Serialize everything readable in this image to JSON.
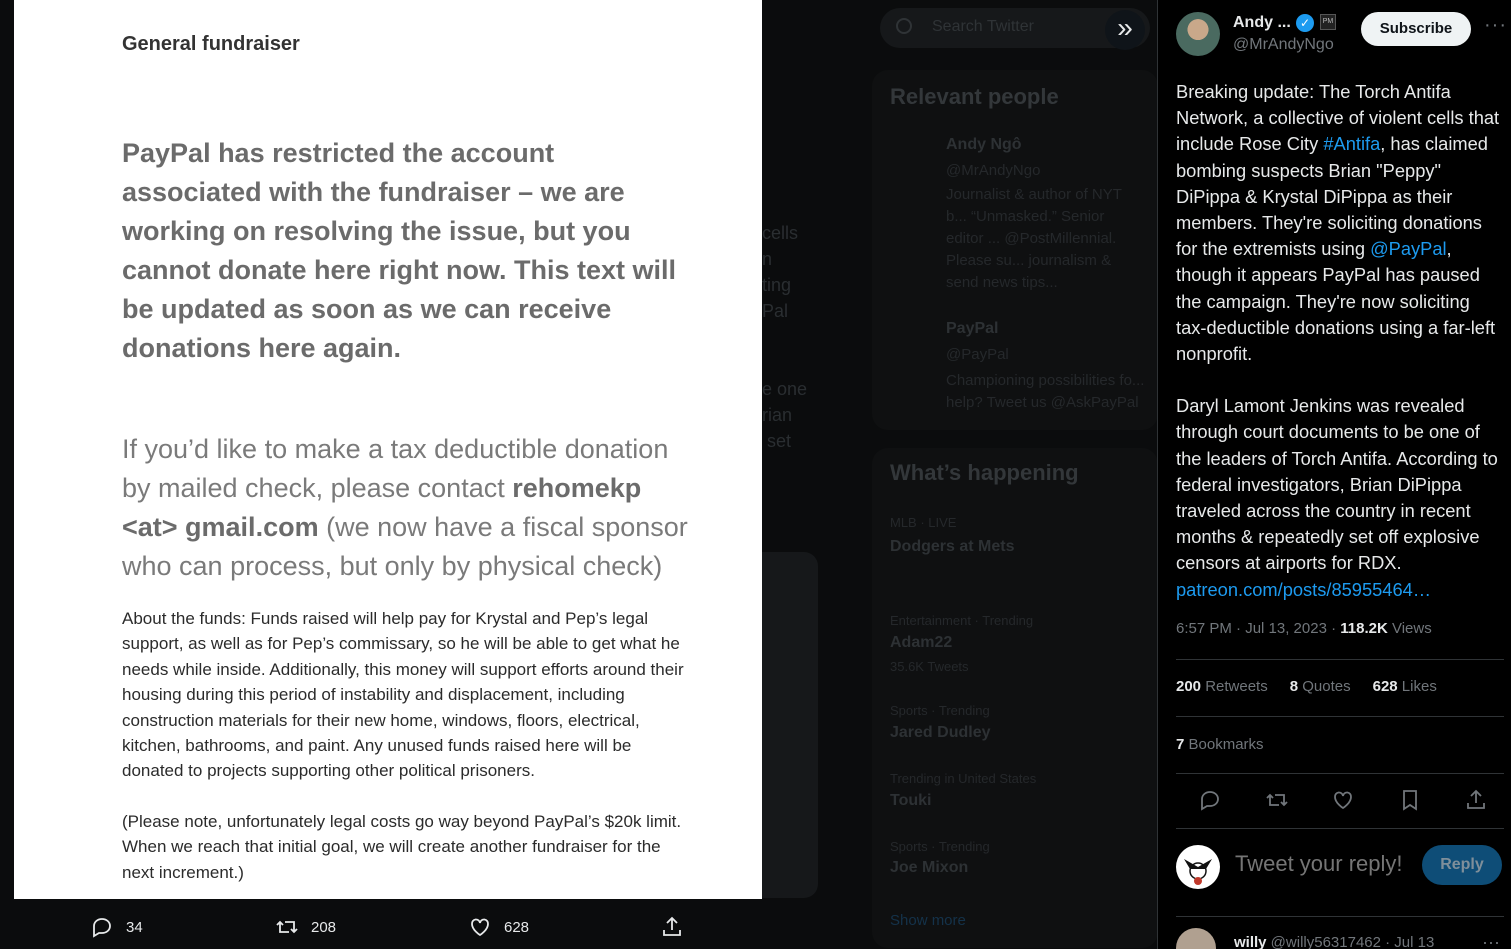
{
  "background": {
    "search_placeholder": "Search Twitter",
    "relevant_people_heading": "Relevant people",
    "rp1_name": "Andy Ngô",
    "rp1_handle": "@MrAndyNgo",
    "rp1_bio": "Journalist & author of NYT b... “Unmasked.” Senior editor ... @PostMillennial. Please su... journalism & send news tips... linktr.ee/andyngo",
    "rp2_name": "PayPal",
    "rp2_handle": "@PayPal",
    "rp2_bio": "Championing possibilities fo... help? Tweet us @AskPayPal",
    "whats_happening_heading": "What’s happening",
    "trend1_meta": "MLB · LIVE",
    "trend1_title": "Dodgers at Mets",
    "trend2_meta": "Entertainment · Trending",
    "trend2_title": "Adam22",
    "trend2_count": "35.6K Tweets",
    "trend3_meta": "Sports · Trending",
    "trend3_title": "Jared Dudley",
    "trend4_meta": "Trending in United States",
    "trend4_title": "Touki",
    "trend5_meta": "Sports · Trending",
    "trend5_title": "Joe Mixon",
    "show_more": "Show more",
    "mid_text": "cells\nn\nting\nPal\n\n\ne one\nrian\n set"
  },
  "photo": {
    "title": "General fundraiser",
    "notice": "PayPal has restricted the account associated with the fundraiser – we are working on resolving the issue, but you cannot donate here right now. This text will be updated as soon as we can receive donations here again.",
    "tax_prefix": "If you’d like to make a tax deductible donation by mailed check, please contact ",
    "tax_email": "rehomekp <at> gmail.com",
    "tax_suffix": " (we now have a fiscal sponsor who can process, but only by physical check)",
    "funds": "About the funds: Funds raised will help pay for Krystal and Pep’s legal support, as well as for Pep’s commissary, so he will be able to get what he needs while inside. Additionally, this money will support efforts around their housing during this period of instability and displacement, including construction materials for their new home, windows, floors, electrical, kitchen, bathrooms, and paint. Any unused funds raised here will be donated to projects supporting other political prisoners.",
    "note": "(Please note, unfortunately legal costs go way beyond PayPal’s $20k limit. When we reach that initial goal, we will create another fundraiser for the next increment.)"
  },
  "actions": {
    "replies": "34",
    "retweets": "208",
    "likes": "628"
  },
  "tweet": {
    "author_name": "Andy ...",
    "author_handle": "@MrAndyNgo",
    "subscribe_label": "Subscribe",
    "affiliate_badge": "PM",
    "p1_a": "Breaking update: The Torch Antifa Network, a collective of violent cells that include Rose City ",
    "p1_tag": "#Antifa",
    "p1_b": ", has claimed bombing suspects Brian \"Peppy\" DiPippa & Krystal DiPippa as their members. They're soliciting donations for the extremists using ",
    "p1_mention": "@PayPal",
    "p1_c": ", though it appears PayPal has paused the campaign. They're now soliciting tax-deductible donations using a far-left nonprofit.",
    "p2": "Daryl Lamont Jenkins was revealed through court documents to be one of the leaders of Torch Antifa. According to federal investigators, Brian DiPippa traveled across the country in recent months & repeatedly set off explosive censors at airports for RDX.",
    "p2_link": "patreon.com/posts/85955464…",
    "time": "6:57 PM · Jul 13, 2023 · ",
    "views_count": "118.2K",
    "views_label": " Views",
    "retweets_count": "200",
    "retweets_label": " Retweets",
    "quotes_count": "8",
    "quotes_label": " Quotes",
    "likes_count": "628",
    "likes_label": " Likes",
    "bookmarks_count": "7",
    "bookmarks_label": " Bookmarks",
    "reply_placeholder": "Tweet your reply!",
    "reply_button": "Reply",
    "next_reply_name": "willy",
    "next_reply_handle": " @willy56317462 · Jul 13"
  },
  "colors": {
    "accent": "#1d9bf0",
    "background": "#000000"
  }
}
